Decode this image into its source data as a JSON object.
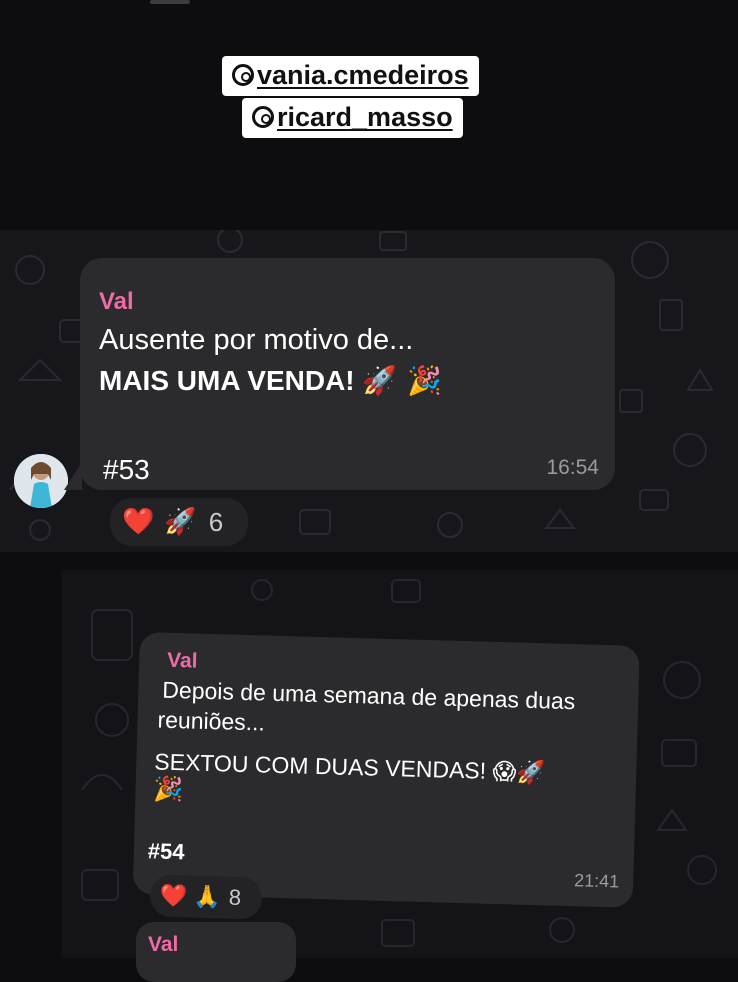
{
  "overlay": {
    "handle1": "vania.cmedeiros",
    "handle2": "ricard_masso",
    "handle_icon": "threads-icon"
  },
  "message1": {
    "sender": "Val",
    "line1": "Ausente por motivo de...",
    "line2": "MAIS UMA VENDA!",
    "emoji": "🚀 🎉",
    "tag": "#53",
    "time": "16:54",
    "reactions": {
      "heart": "❤️",
      "rocket": "🚀",
      "count": "6"
    }
  },
  "message2": {
    "sender": "Val",
    "line1": "Depois de uma semana de apenas duas",
    "line2": "reuniões...",
    "line3": "SEXTOU COM DUAS VENDAS!",
    "line3_emoji": "😱🚀",
    "line4_emoji": "🎉",
    "tag": "#54",
    "time": "21:41",
    "reactions": {
      "heart": "❤️",
      "pray": "🙏",
      "count": "8"
    }
  },
  "message3": {
    "sender": "Val"
  },
  "colors": {
    "background": "#0d0d0f",
    "bubble": "#2b2b2e",
    "sender": "#f06aa7",
    "time": "#9a9a9f"
  }
}
